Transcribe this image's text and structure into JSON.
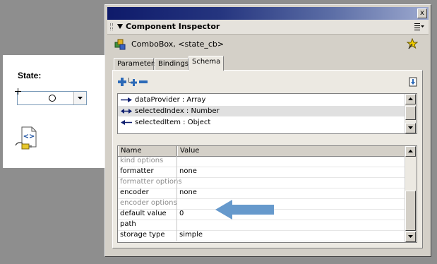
{
  "stage": {
    "state_label": "State:"
  },
  "panel": {
    "title": "Component Inspector",
    "close_glyph": "x",
    "component": "ComboBox, <state_cb>",
    "tabs": [
      {
        "label": "Parameters",
        "active": false
      },
      {
        "label": "Bindings",
        "active": false
      },
      {
        "label": "Schema",
        "active": true
      }
    ],
    "schema_items": [
      {
        "label": "dataProvider : Array",
        "direction": "in",
        "selected": false
      },
      {
        "label": "selectedIndex : Number",
        "direction": "in-out",
        "selected": true
      },
      {
        "label": "selectedItem : Object",
        "direction": "out",
        "selected": false
      }
    ],
    "grid": {
      "columns": [
        "Name",
        "Value"
      ],
      "rows": [
        {
          "name": "kind options",
          "value": "",
          "dim": true
        },
        {
          "name": "formatter",
          "value": "none",
          "dim": false
        },
        {
          "name": "formatter options",
          "value": "",
          "dim": true
        },
        {
          "name": "encoder",
          "value": "none",
          "dim": false
        },
        {
          "name": "encoder options",
          "value": "",
          "dim": true
        },
        {
          "name": "default value",
          "value": "0",
          "dim": false
        },
        {
          "name": "path",
          "value": "",
          "dim": false
        },
        {
          "name": "storage type",
          "value": "simple",
          "dim": false
        }
      ]
    }
  },
  "icons": {
    "component": "combobox-component-icon",
    "pin": "pin-icon",
    "add_field": "add-field-icon",
    "add_subfield": "add-subfield-icon",
    "remove_field": "remove-field-icon",
    "import_schema": "import-schema-icon",
    "options": "panel-options-icon",
    "callout": "pointer-arrow"
  },
  "colors": {
    "panel_bg": "#d4d0c8",
    "title_gradient_start": "#0e1a6a",
    "callout_arrow": "#6699cc",
    "selected_row": "#e0e0e0"
  }
}
